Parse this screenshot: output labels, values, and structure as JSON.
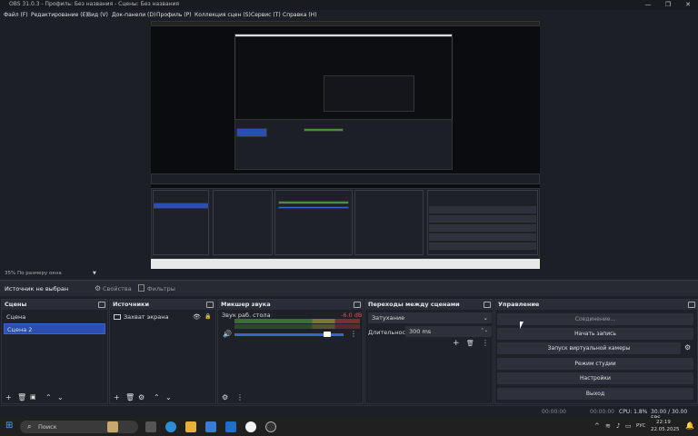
{
  "window": {
    "title": "OBS 31.0.3 - Профиль: Без названия - Сцены: Без названия"
  },
  "menu": [
    "Файл (F)",
    "Редактирование (E)",
    "Вид (V)",
    "Док-панели (D)",
    "Профиль (P)",
    "Коллекция сцен (S)",
    "Сервис (T)",
    "Справка (H)"
  ],
  "zoom": {
    "label": "35% По размеру окна"
  },
  "source_bar": {
    "status": "Источник не выбран",
    "properties": "Свойства",
    "filters": "Фильтры"
  },
  "scenes": {
    "title": "Сцены",
    "items": [
      "Сцена",
      "Сцена 2"
    ],
    "selected_index": 1
  },
  "sources": {
    "title": "Источники",
    "items": [
      "Захват экрана"
    ]
  },
  "mixer": {
    "title": "Микшер звука",
    "track": "Звук раб. стола",
    "db": "-6.0 dB",
    "volume_level": 0.9
  },
  "transitions": {
    "title": "Переходы между сценами",
    "type": "Затухание",
    "duration_label": "Длительность",
    "duration_value": "300 ms"
  },
  "controls": {
    "title": "Управление",
    "connecting": "Соединение...",
    "start_recording": "Начать запись",
    "virtual_cam": "Запуск виртуальной камеры",
    "studio_mode": "Режим студии",
    "settings": "Настройки",
    "exit": "Выход"
  },
  "status": {
    "time1": "00:00:00",
    "time2": "00:00:00",
    "cpu": "CPU: 1.8%",
    "fps": "30.00 / 30.00 FPS"
  },
  "taskbar": {
    "search": "Поиск",
    "lang": "РУС",
    "clock": "22:19",
    "date": "22.05.2025"
  }
}
